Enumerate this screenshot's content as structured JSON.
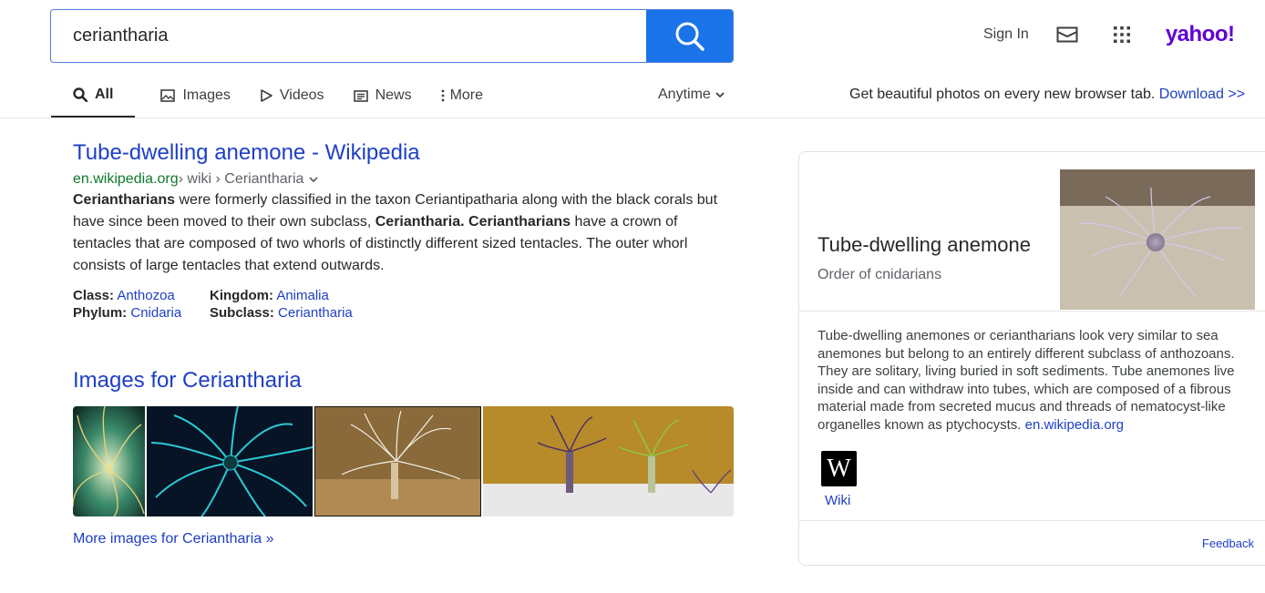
{
  "search": {
    "query": "ceriantharia"
  },
  "header": {
    "sign_in": "Sign In",
    "logo": "yahoo!"
  },
  "tabs": [
    {
      "label": "All",
      "icon": "search-icon"
    },
    {
      "label": "Images",
      "icon": "image-icon"
    },
    {
      "label": "Videos",
      "icon": "play-icon"
    },
    {
      "label": "News",
      "icon": "newspaper-icon"
    },
    {
      "label": "More",
      "icon": "more-vertical-icon"
    }
  ],
  "anytime": "Anytime",
  "promo": {
    "text": "Get beautiful photos on every new browser tab.",
    "link": "Download >>"
  },
  "result": {
    "title": "Tube-dwelling anemone - Wikipedia",
    "url_domain": "en.wikipedia.org",
    "url_path": " › wiki › Ceriantharia",
    "snippet_parts": [
      "Ceriantharians",
      " were formerly classified in the taxon Ceriantipatharia along with the black corals but have since been moved to their own subclass, ",
      "Ceriantharia.",
      " ",
      "Ceriantharians",
      " have a crown of tentacles that are composed of two whorls of distinctly different sized tentacles. The outer whorl consists of large tentacles that extend outwards."
    ],
    "facts": [
      {
        "key": "Class:",
        "value": "Anthozoa"
      },
      {
        "key": "Kingdom:",
        "value": "Animalia"
      },
      {
        "key": "Phylum:",
        "value": "Cnidaria"
      },
      {
        "key": "Subclass:",
        "value": "Ceriantharia"
      }
    ]
  },
  "images": {
    "title": "Images for Ceriantharia",
    "more": "More images for Ceriantharia »"
  },
  "knowledge_panel": {
    "title": "Tube-dwelling anemone",
    "subtitle": "Order of cnidarians",
    "description": "Tube-dwelling anemones or ceriantharians look very similar to sea anemones but belong to an entirely different subclass of anthozoans. They are solitary, living buried in soft sediments. Tube anemones live inside and can withdraw into tubes, which are composed of a fibrous material made from secreted mucus and threads of nematocyst-like organelles known as ptychocysts.",
    "source_link": "en.wikipedia.org",
    "wiki_icon_letter": "W",
    "wiki_label": "Wiki",
    "feedback": "Feedback"
  },
  "colors": {
    "accent": "#1a73e8",
    "link": "#1e3fc5",
    "url_green": "#0f7b2a",
    "brand": "#6001d2"
  }
}
